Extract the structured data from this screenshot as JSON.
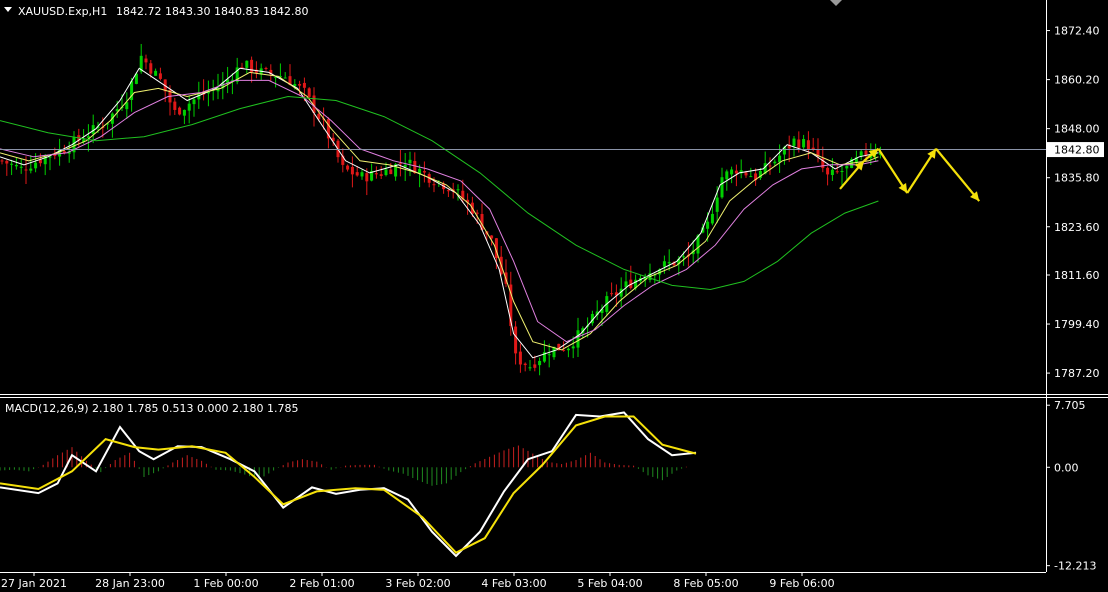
{
  "window": {
    "symbol_header": "XAUUSD.Exp,H1",
    "ohlc_header": "1842.72 1843.30 1840.83 1842.80"
  },
  "indicator_header": "MACD(12,26,9) 2.180 1.785 0.513 0.000 2.180 1.785",
  "current_price_label": "1842.80",
  "colors": {
    "background": "#000000",
    "bull_candle": "#00d000",
    "bear_candle": "#e01818",
    "ma_fast": "#ffffff",
    "ma_mid": "#f0f070",
    "ma_slow": "#e080e0",
    "ma_long": "#20c020",
    "forecast_arrow": "#f5e10a",
    "macd_line": "#ffffff",
    "signal_line": "#f5e10a",
    "hist_pos": "#c82020",
    "hist_neg": "#1f8a1f",
    "grid_axis": "#ffffff"
  },
  "chart_data": [
    {
      "type": "candlestick",
      "title": "XAUUSD.Exp,H1",
      "y_ticks": [
        "1872.40",
        "1860.20",
        "1848.00",
        "1835.80",
        "1823.60",
        "1811.60",
        "1799.40",
        "1787.20"
      ],
      "y_tick_values": [
        1872.4,
        1860.2,
        1848.0,
        1835.8,
        1823.6,
        1811.6,
        1799.4,
        1787.2
      ],
      "ylim": [
        1782.0,
        1880.0
      ],
      "current_price": 1842.8,
      "x_ticks": [
        "27 Jan 2021",
        "28 Jan 23:00",
        "1 Feb 00:00",
        "2 Feb 01:00",
        "3 Feb 02:00",
        "4 Feb 03:00",
        "5 Feb 04:00",
        "8 Feb 05:00",
        "9 Feb 06:00"
      ],
      "close_path": [
        [
          0,
          1840
        ],
        [
          8,
          1838
        ],
        [
          18,
          1841
        ],
        [
          26,
          1843
        ],
        [
          34,
          1846
        ],
        [
          44,
          1850
        ],
        [
          52,
          1856
        ],
        [
          58,
          1866
        ],
        [
          66,
          1860
        ],
        [
          72,
          1852
        ],
        [
          82,
          1856
        ],
        [
          92,
          1859
        ],
        [
          100,
          1864
        ],
        [
          108,
          1862
        ],
        [
          118,
          1861
        ],
        [
          126,
          1857
        ],
        [
          134,
          1849
        ],
        [
          142,
          1838
        ],
        [
          150,
          1836
        ],
        [
          158,
          1837
        ],
        [
          168,
          1840
        ],
        [
          178,
          1836
        ],
        [
          188,
          1833
        ],
        [
          196,
          1828
        ],
        [
          204,
          1820
        ],
        [
          210,
          1808
        ],
        [
          214,
          1791
        ],
        [
          220,
          1789
        ],
        [
          228,
          1793
        ],
        [
          236,
          1794
        ],
        [
          244,
          1799
        ],
        [
          252,
          1805
        ],
        [
          260,
          1809
        ],
        [
          268,
          1812
        ],
        [
          276,
          1814
        ],
        [
          286,
          1816
        ],
        [
          294,
          1824
        ],
        [
          300,
          1836
        ],
        [
          306,
          1838
        ],
        [
          314,
          1836
        ],
        [
          322,
          1840
        ],
        [
          330,
          1845
        ],
        [
          336,
          1844
        ],
        [
          344,
          1836
        ],
        [
          352,
          1838
        ],
        [
          360,
          1842
        ],
        [
          366,
          1843
        ]
      ],
      "moving_averages": [
        {
          "key": "ma_fast",
          "points": [
            [
              0,
              1841
            ],
            [
              10,
              1839
            ],
            [
              20,
              1841
            ],
            [
              30,
              1844
            ],
            [
              40,
              1848
            ],
            [
              50,
              1855
            ],
            [
              58,
              1863
            ],
            [
              68,
              1859
            ],
            [
              78,
              1855
            ],
            [
              90,
              1858
            ],
            [
              100,
              1863
            ],
            [
              112,
              1862
            ],
            [
              124,
              1858
            ],
            [
              134,
              1849
            ],
            [
              144,
              1840
            ],
            [
              154,
              1837
            ],
            [
              166,
              1839
            ],
            [
              178,
              1836
            ],
            [
              190,
              1832
            ],
            [
              200,
              1824
            ],
            [
              208,
              1813
            ],
            [
              214,
              1797
            ],
            [
              222,
              1791
            ],
            [
              232,
              1793
            ],
            [
              242,
              1797
            ],
            [
              252,
              1804
            ],
            [
              262,
              1809
            ],
            [
              272,
              1812
            ],
            [
              282,
              1815
            ],
            [
              292,
              1822
            ],
            [
              300,
              1834
            ],
            [
              308,
              1837
            ],
            [
              318,
              1838
            ],
            [
              328,
              1844
            ],
            [
              338,
              1842
            ],
            [
              348,
              1838
            ],
            [
              358,
              1841
            ],
            [
              366,
              1842
            ]
          ]
        },
        {
          "key": "ma_mid",
          "points": [
            [
              0,
              1842
            ],
            [
              12,
              1840
            ],
            [
              24,
              1842
            ],
            [
              36,
              1845
            ],
            [
              46,
              1850
            ],
            [
              56,
              1857
            ],
            [
              66,
              1858
            ],
            [
              78,
              1856
            ],
            [
              92,
              1858
            ],
            [
              104,
              1862
            ],
            [
              116,
              1861
            ],
            [
              128,
              1856
            ],
            [
              138,
              1848
            ],
            [
              150,
              1840
            ],
            [
              162,
              1839
            ],
            [
              174,
              1837
            ],
            [
              186,
              1834
            ],
            [
              196,
              1829
            ],
            [
              206,
              1819
            ],
            [
              214,
              1805
            ],
            [
              222,
              1795
            ],
            [
              234,
              1793
            ],
            [
              246,
              1797
            ],
            [
              258,
              1805
            ],
            [
              270,
              1811
            ],
            [
              282,
              1814
            ],
            [
              294,
              1820
            ],
            [
              304,
              1830
            ],
            [
              314,
              1835
            ],
            [
              326,
              1840
            ],
            [
              338,
              1842
            ],
            [
              350,
              1839
            ],
            [
              362,
              1840
            ],
            [
              366,
              1841
            ]
          ]
        },
        {
          "key": "ma_slow",
          "points": [
            [
              0,
              1843
            ],
            [
              14,
              1841
            ],
            [
              28,
              1842
            ],
            [
              42,
              1846
            ],
            [
              56,
              1852
            ],
            [
              70,
              1856
            ],
            [
              84,
              1857
            ],
            [
              98,
              1860
            ],
            [
              112,
              1860
            ],
            [
              126,
              1856
            ],
            [
              138,
              1850
            ],
            [
              150,
              1843
            ],
            [
              164,
              1840
            ],
            [
              178,
              1838
            ],
            [
              192,
              1835
            ],
            [
              204,
              1828
            ],
            [
              214,
              1815
            ],
            [
              224,
              1800
            ],
            [
              236,
              1795
            ],
            [
              248,
              1798
            ],
            [
              260,
              1804
            ],
            [
              272,
              1809
            ],
            [
              286,
              1813
            ],
            [
              298,
              1819
            ],
            [
              310,
              1828
            ],
            [
              322,
              1834
            ],
            [
              334,
              1838
            ],
            [
              346,
              1839
            ],
            [
              358,
              1839
            ],
            [
              366,
              1840
            ]
          ]
        },
        {
          "key": "ma_long",
          "points": [
            [
              0,
              1850
            ],
            [
              20,
              1847
            ],
            [
              40,
              1845
            ],
            [
              60,
              1846
            ],
            [
              80,
              1849
            ],
            [
              100,
              1853
            ],
            [
              120,
              1856
            ],
            [
              140,
              1855
            ],
            [
              160,
              1851
            ],
            [
              180,
              1845
            ],
            [
              200,
              1837
            ],
            [
              220,
              1827
            ],
            [
              240,
              1819
            ],
            [
              260,
              1813
            ],
            [
              280,
              1809
            ],
            [
              296,
              1808
            ],
            [
              310,
              1810
            ],
            [
              324,
              1815
            ],
            [
              338,
              1822
            ],
            [
              352,
              1827
            ],
            [
              366,
              1830
            ]
          ]
        }
      ],
      "forecast_path": [
        [
          350,
          1833
        ],
        [
          360,
          1840
        ],
        [
          366,
          1843
        ],
        [
          378,
          1832
        ],
        [
          390,
          1843
        ],
        [
          408,
          1830
        ]
      ]
    },
    {
      "type": "line",
      "title": "MACD(12,26,9)",
      "y_ticks": [
        "7.705",
        "0.00",
        "-12.213"
      ],
      "y_tick_values": [
        7.705,
        0.0,
        -12.213
      ],
      "ylim": [
        -13.0,
        8.6
      ],
      "series": [
        {
          "key": "macd_line",
          "points": [
            [
              0,
              -2.5
            ],
            [
              16,
              -3.2
            ],
            [
              24,
              -2.0
            ],
            [
              30,
              1.5
            ],
            [
              40,
              -0.5
            ],
            [
              50,
              5.0
            ],
            [
              58,
              2.0
            ],
            [
              64,
              1.0
            ],
            [
              74,
              2.6
            ],
            [
              84,
              2.5
            ],
            [
              96,
              1.0
            ],
            [
              106,
              -0.5
            ],
            [
              118,
              -5.0
            ],
            [
              130,
              -2.5
            ],
            [
              140,
              -3.3
            ],
            [
              150,
              -2.8
            ],
            [
              160,
              -2.6
            ],
            [
              170,
              -4.0
            ],
            [
              180,
              -8.0
            ],
            [
              190,
              -11.0
            ],
            [
              200,
              -8.0
            ],
            [
              210,
              -3.0
            ],
            [
              220,
              1.0
            ],
            [
              230,
              2.0
            ],
            [
              240,
              6.5
            ],
            [
              250,
              6.3
            ],
            [
              260,
              6.8
            ],
            [
              270,
              3.5
            ],
            [
              280,
              1.5
            ],
            [
              290,
              1.8
            ]
          ]
        },
        {
          "key": "signal_line",
          "points": [
            [
              0,
              -2.0
            ],
            [
              16,
              -2.7
            ],
            [
              30,
              -0.5
            ],
            [
              44,
              3.5
            ],
            [
              56,
              2.5
            ],
            [
              66,
              2.2
            ],
            [
              80,
              2.6
            ],
            [
              94,
              1.8
            ],
            [
              106,
              -1.2
            ],
            [
              118,
              -4.6
            ],
            [
              132,
              -3.0
            ],
            [
              148,
              -2.6
            ],
            [
              160,
              -2.8
            ],
            [
              176,
              -6.2
            ],
            [
              190,
              -10.6
            ],
            [
              202,
              -8.8
            ],
            [
              214,
              -3.2
            ],
            [
              226,
              0.3
            ],
            [
              240,
              5.2
            ],
            [
              252,
              6.3
            ],
            [
              264,
              6.3
            ],
            [
              276,
              2.8
            ],
            [
              290,
              1.7
            ]
          ]
        }
      ],
      "histogram": [
        {
          "x": 0,
          "v": -0.4
        },
        {
          "x": 6,
          "v": -0.3
        },
        {
          "x": 12,
          "v": -0.5
        },
        {
          "x": 18,
          "v": 0.3
        },
        {
          "x": 24,
          "v": 1.5
        },
        {
          "x": 30,
          "v": 2.5
        },
        {
          "x": 36,
          "v": 0.8
        },
        {
          "x": 42,
          "v": -0.6
        },
        {
          "x": 48,
          "v": 0.9
        },
        {
          "x": 54,
          "v": 1.8
        },
        {
          "x": 60,
          "v": -1.2
        },
        {
          "x": 66,
          "v": -0.5
        },
        {
          "x": 72,
          "v": 0.6
        },
        {
          "x": 78,
          "v": 1.5
        },
        {
          "x": 84,
          "v": 0.8
        },
        {
          "x": 90,
          "v": -0.3
        },
        {
          "x": 96,
          "v": -0.4
        },
        {
          "x": 102,
          "v": -0.9
        },
        {
          "x": 108,
          "v": -1.5
        },
        {
          "x": 114,
          "v": -0.4
        },
        {
          "x": 120,
          "v": 0.6
        },
        {
          "x": 126,
          "v": 1.0
        },
        {
          "x": 132,
          "v": 0.7
        },
        {
          "x": 138,
          "v": -0.3
        },
        {
          "x": 144,
          "v": 0.2
        },
        {
          "x": 150,
          "v": 0.3
        },
        {
          "x": 156,
          "v": 0.3
        },
        {
          "x": 162,
          "v": -0.4
        },
        {
          "x": 168,
          "v": -0.8
        },
        {
          "x": 174,
          "v": -1.6
        },
        {
          "x": 180,
          "v": -2.3
        },
        {
          "x": 186,
          "v": -2.0
        },
        {
          "x": 192,
          "v": -0.6
        },
        {
          "x": 198,
          "v": 0.5
        },
        {
          "x": 204,
          "v": 1.3
        },
        {
          "x": 210,
          "v": 2.1
        },
        {
          "x": 216,
          "v": 2.7
        },
        {
          "x": 222,
          "v": 1.7
        },
        {
          "x": 228,
          "v": 0.7
        },
        {
          "x": 234,
          "v": 0.4
        },
        {
          "x": 240,
          "v": 0.9
        },
        {
          "x": 246,
          "v": 1.8
        },
        {
          "x": 252,
          "v": 0.6
        },
        {
          "x": 258,
          "v": 0.3
        },
        {
          "x": 264,
          "v": 0.2
        },
        {
          "x": 270,
          "v": -1.0
        },
        {
          "x": 276,
          "v": -1.6
        },
        {
          "x": 282,
          "v": -0.4
        },
        {
          "x": 288,
          "v": 0.3
        }
      ]
    }
  ]
}
